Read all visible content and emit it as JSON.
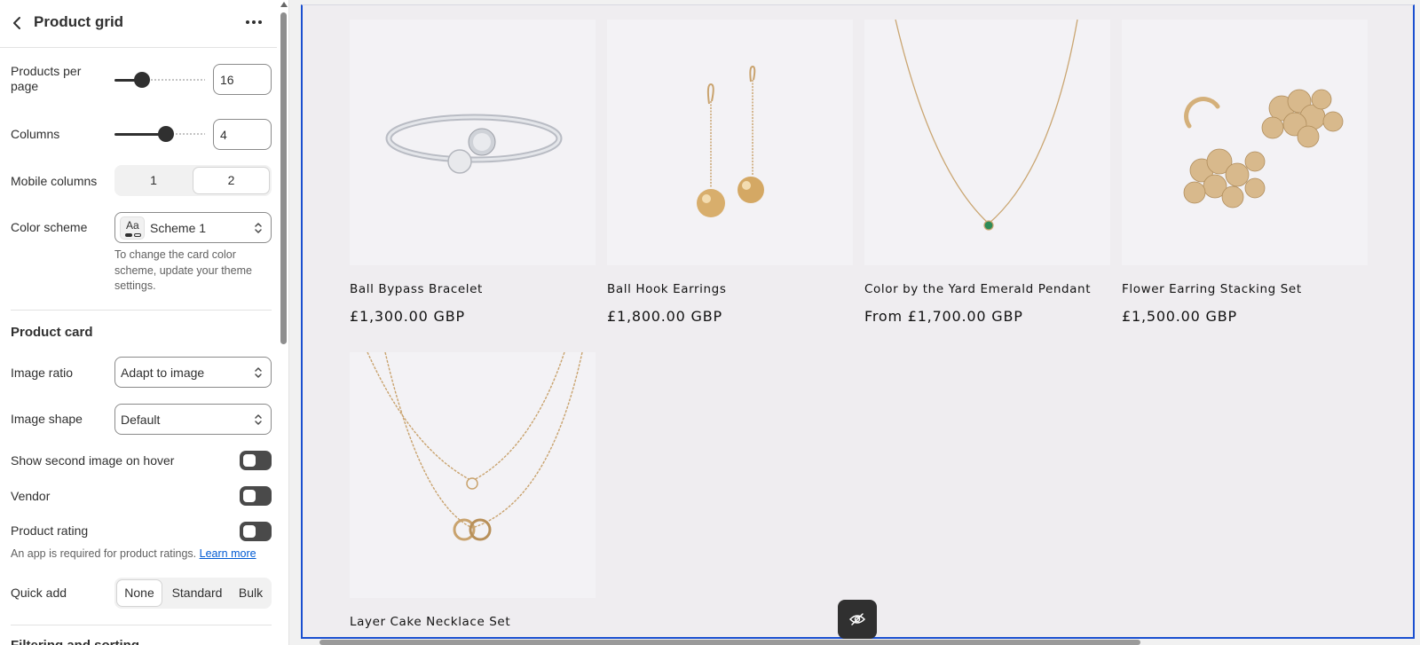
{
  "sidebar": {
    "title": "Product grid",
    "products_per_page": {
      "label": "Products per page",
      "value": "16",
      "slider_fraction": 0.3
    },
    "columns": {
      "label": "Columns",
      "value": "4",
      "slider_fraction": 0.57
    },
    "mobile_columns": {
      "label": "Mobile columns",
      "options": [
        "1",
        "2"
      ],
      "selected": "2"
    },
    "color_scheme": {
      "label": "Color scheme",
      "value": "Scheme 1",
      "chip_text": "Aa",
      "help": "To change the card color scheme, update your theme settings."
    },
    "product_card": {
      "heading": "Product card",
      "image_ratio": {
        "label": "Image ratio",
        "value": "Adapt to image"
      },
      "image_shape": {
        "label": "Image shape",
        "value": "Default"
      },
      "show_second_image": {
        "label": "Show second image on hover",
        "on": false
      },
      "vendor": {
        "label": "Vendor",
        "on": false
      },
      "product_rating": {
        "label": "Product rating",
        "on": false
      },
      "rating_help": "An app is required for product ratings.",
      "rating_link": "Learn more",
      "quick_add": {
        "label": "Quick add",
        "options": [
          "None",
          "Standard",
          "Bulk"
        ],
        "selected": "None"
      }
    },
    "next_section": "Filtering and sorting"
  },
  "products": [
    {
      "title": "Ball Bypass Bracelet",
      "price": "£1,300.00 GBP"
    },
    {
      "title": "Ball Hook Earrings",
      "price": "£1,800.00 GBP"
    },
    {
      "title": "Color by the Yard Emerald Pendant",
      "price": "From £1,700.00 GBP"
    },
    {
      "title": "Flower Earring Stacking Set",
      "price": "£1,500.00 GBP"
    },
    {
      "title": "Layer Cake Necklace Set",
      "price": ""
    }
  ],
  "colors": {
    "accent_frame": "#1a4fd0",
    "toggle_off": "#4a4a4a",
    "link": "#005bd3"
  },
  "icons": [
    "back-icon",
    "more-icon",
    "updown-icon",
    "eye-off-icon"
  ]
}
